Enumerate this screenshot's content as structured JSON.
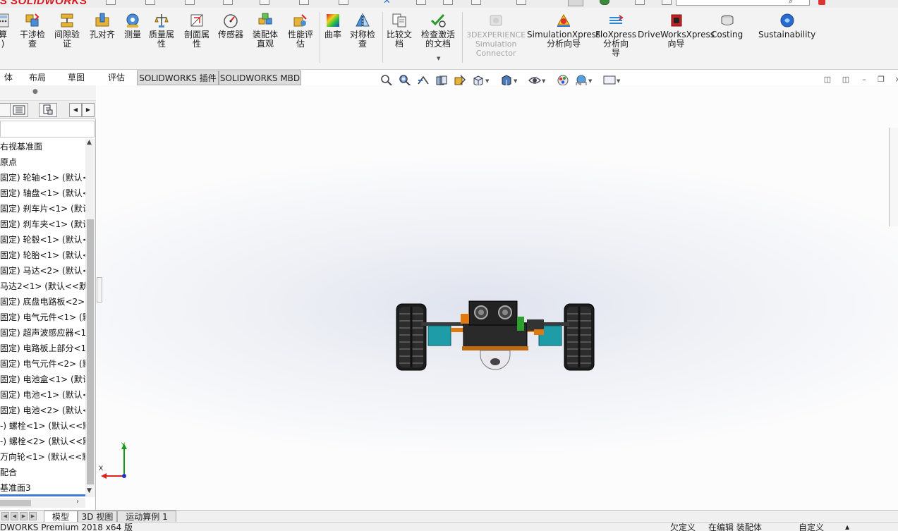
{
  "app": {
    "logo": "S SOLIDWORKS"
  },
  "ribbon": {
    "buttons": [
      {
        "label": "算\n)",
        "icon": "calculate-icon"
      },
      {
        "label": "干涉检\n查",
        "icon": "interference-check-icon"
      },
      {
        "label": "间隙验\n证",
        "icon": "clearance-verify-icon"
      },
      {
        "label": "孔对齐",
        "icon": "hole-align-icon"
      },
      {
        "label": "测量",
        "icon": "measure-icon"
      },
      {
        "label": "质量属\n性",
        "icon": "mass-properties-icon"
      },
      {
        "label": "剖面属\n性",
        "icon": "section-properties-icon"
      },
      {
        "label": "传感器",
        "icon": "sensor-icon"
      },
      {
        "label": "装配体\n直观",
        "icon": "assembly-visualization-icon"
      },
      {
        "label": "性能评\n估",
        "icon": "performance-evaluation-icon"
      },
      {
        "label": "曲率",
        "icon": "curvature-icon"
      },
      {
        "label": "对称检\n查",
        "icon": "symmetry-check-icon"
      },
      {
        "label": "比较文\n档",
        "icon": "compare-documents-icon"
      },
      {
        "label": "检查激活\n的文档",
        "icon": "check-active-document-icon"
      },
      {
        "label": "3DEXPERIENCE\nSimulation\nConnector",
        "icon": "3dexperience-connector-icon"
      },
      {
        "label": "SimulationXpress\n分析向导",
        "icon": "simulationxpress-icon"
      },
      {
        "label": "FloXpress\n分析向\n导",
        "icon": "floxpress-icon"
      },
      {
        "label": "DriveWorksXpress\n向导",
        "icon": "driveworksxpress-icon"
      },
      {
        "label": "Costing",
        "icon": "costing-icon"
      },
      {
        "label": "Sustainability",
        "icon": "sustainability-icon"
      }
    ]
  },
  "tabs": [
    {
      "label": "体"
    },
    {
      "label": "布局"
    },
    {
      "label": "草图"
    },
    {
      "label": "评估"
    },
    {
      "label": "SOLIDWORKS 插件"
    },
    {
      "label": "SOLIDWORKS MBD"
    }
  ],
  "tree": {
    "items": [
      {
        "label": "右视基准面"
      },
      {
        "label": "原点"
      },
      {
        "label": "固定) 轮轴<1> (默认<"
      },
      {
        "label": "固定) 轴盘<1> (默认<"
      },
      {
        "label": "固定) 刹车片<1> (默认"
      },
      {
        "label": "固定) 刹车夹<1> (默认"
      },
      {
        "label": "固定) 轮毂<1> (默认<"
      },
      {
        "label": "固定) 轮胎<1> (默认<"
      },
      {
        "label": "固定) 马达<2> (默认<"
      },
      {
        "label": "马达2<1> (默认<<默认"
      },
      {
        "label": "固定) 底盘电路板<2>"
      },
      {
        "label": "固定) 电气元件<1> (默"
      },
      {
        "label": "固定) 超声波感应器<1"
      },
      {
        "label": "固定) 电路板上部分<1"
      },
      {
        "label": "固定) 电气元件<2> (默"
      },
      {
        "label": "固定) 电池盒<1> (默认"
      },
      {
        "label": "固定) 电池<1> (默认<"
      },
      {
        "label": "固定) 电池<2> (默认<"
      },
      {
        "label": "-) 螺栓<1> (默认<<默"
      },
      {
        "label": "-) 螺栓<2> (默认<<默"
      },
      {
        "label": "万向轮<1> (默认<<默"
      },
      {
        "label": "配合"
      },
      {
        "label": "基准面3"
      }
    ]
  },
  "triad": {
    "x_label": "X",
    "y_label": "Y"
  },
  "bottom_tabs": [
    {
      "label": "模型"
    },
    {
      "label": "3D 视图"
    },
    {
      "label": "运动算例 1"
    }
  ],
  "status": {
    "product": "DWORKS Premium 2018 x64 版",
    "state1": "欠定义",
    "state2": "在编辑 装配体",
    "custom": "自定义"
  },
  "colors": {
    "brand_red": "#d71920",
    "accent_blue": "#3e7bd6",
    "motor_teal": "#1e9ca8",
    "part_orange": "#e07a10"
  }
}
